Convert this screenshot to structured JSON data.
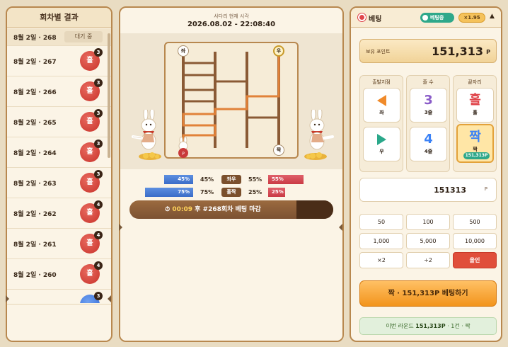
{
  "left": {
    "title": "회차별 결과",
    "rows": [
      {
        "label": "8월 2일 · 268",
        "status": "대기 중",
        "type": "waiting"
      },
      {
        "label": "8월 2일 · 267",
        "ball": "홀",
        "count": "3",
        "color": "red"
      },
      {
        "label": "8월 2일 · 266",
        "ball": "홀",
        "count": "3",
        "color": "red"
      },
      {
        "label": "8월 2일 · 265",
        "ball": "홀",
        "count": "3",
        "color": "red"
      },
      {
        "label": "8월 2일 · 264",
        "ball": "홀",
        "count": "3",
        "color": "red"
      },
      {
        "label": "8월 2일 · 263",
        "ball": "홀",
        "count": "3",
        "color": "red"
      },
      {
        "label": "8월 2일 · 262",
        "ball": "홀",
        "count": "4",
        "color": "red"
      },
      {
        "label": "8월 2일 · 261",
        "ball": "홀",
        "count": "4",
        "color": "red"
      },
      {
        "label": "8월 2일 · 260",
        "ball": "홀",
        "count": "4",
        "color": "red"
      },
      {
        "label": "",
        "ball": "",
        "count": "3",
        "color": "blue"
      }
    ]
  },
  "center": {
    "time_label": "사다리 현재 시각",
    "time_value": "2026.08.02 - 22:08:40",
    "nodes": {
      "left_top": "좌",
      "right_top": "우",
      "right_bottom": "짝"
    },
    "stats": [
      {
        "left_bar": "45%",
        "left_pct": "45%",
        "label": "좌우",
        "right_pct": "55%",
        "right_bar": "55%",
        "left_value": 45,
        "right_value": 55
      },
      {
        "left_bar": "75%",
        "left_pct": "75%",
        "label": "홀짝",
        "right_pct": "25%",
        "right_bar": "25%",
        "left_value": 75,
        "right_value": 25
      }
    ],
    "countdown": {
      "time": "00:09",
      "text": " 후 #268회차 베팅 마감",
      "remaining_fraction": 0.82
    }
  },
  "right": {
    "title": "베팅",
    "status_badge": "베팅중",
    "multiplier": "×1.95",
    "collapse": "▲",
    "points_label": "보유 포인트",
    "points_value": "151,313",
    "points_unit": "P",
    "columns": {
      "start": {
        "title": "출발지점",
        "a_label": "좌",
        "b_label": "우"
      },
      "lines": {
        "title": "줄 수",
        "a_big": "3",
        "a_label": "3줄",
        "b_big": "4",
        "b_label": "4줄"
      },
      "end": {
        "title": "끝자리",
        "a_big": "홀",
        "a_label": "홀",
        "b_big": "짝",
        "b_label": "짝",
        "b_amount": "151,313P"
      }
    },
    "amount_value": "151313",
    "amount_unit": "P",
    "chips": [
      "50",
      "100",
      "500",
      "1,000",
      "5,000",
      "10,000",
      "×2",
      "÷2",
      "올인"
    ],
    "bet_button": "짝 · 151,313P 베팅하기",
    "summary_prefix": "이번 라운드 ",
    "summary_value": "151,313P",
    "summary_suffix": " · 1건 · 짝",
    "colors": {
      "accent": "#f2941c",
      "odd": "#e0454b",
      "even": "#3b82f6",
      "green": "#2fa88a"
    }
  }
}
